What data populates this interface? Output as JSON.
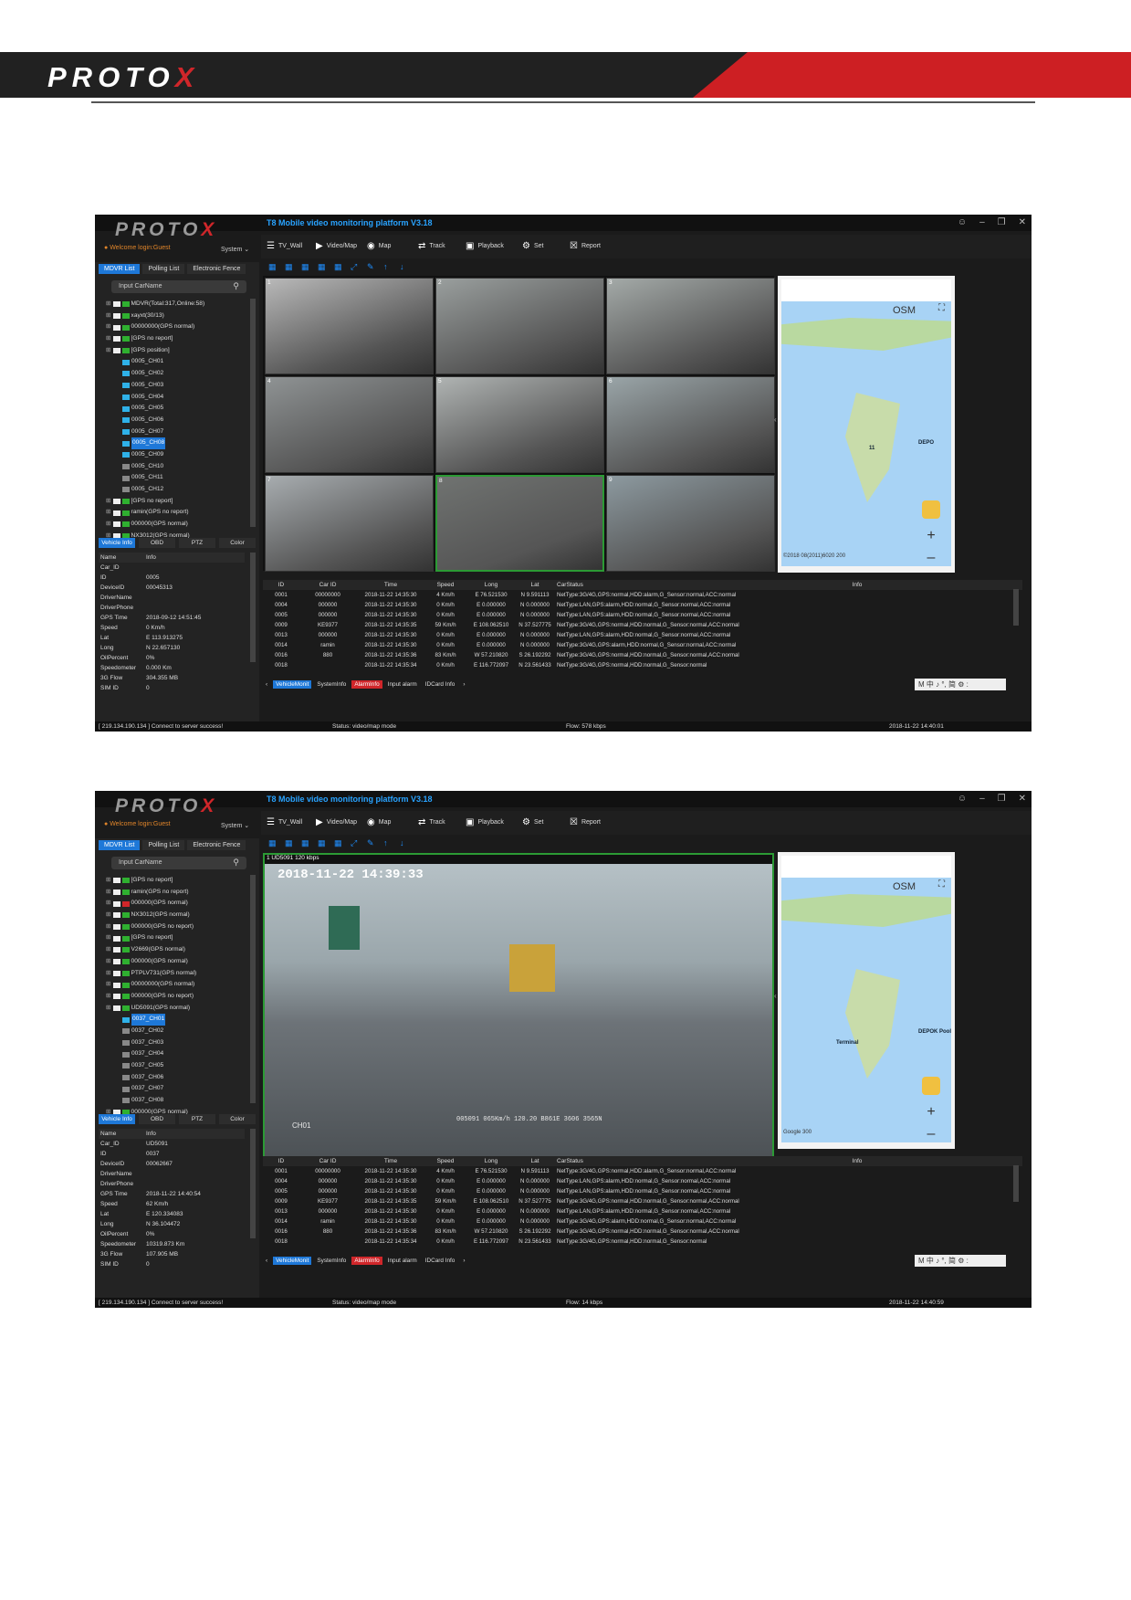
{
  "doc": {
    "brand_left": "PROTO",
    "brand_right": "X"
  },
  "screens": [
    {
      "app_title": "T8 Mobile video monitoring platform V3.18",
      "welcome": "Welcome login:Guest",
      "system_menu": "System",
      "toolbar": [
        "TV_Wall",
        "Video/Map",
        "Map",
        "Track",
        "Playback",
        "Set",
        "Report"
      ],
      "left_tabs": [
        "MDVR List",
        "Polling List",
        "Electronic Fence"
      ],
      "search_placeholder": "Input CarName",
      "tree": [
        "MDVR(Total:317,Online:58)",
        "xayxt(30/13)",
        "00000000(GPS normal)",
        "[GPS no report]",
        "[GPS position]",
        "0005_CH01",
        "0005_CH02",
        "0005_CH03",
        "0005_CH04",
        "0005_CH05",
        "0005_CH06",
        "0005_CH07",
        "0005_CH08",
        "0005_CH09",
        "0005_CH10",
        "0005_CH11",
        "0005_CH12",
        "[GPS no report]",
        "ramin(GPS no report)",
        "000000(GPS normal)",
        "NX3012(GPS normal)"
      ],
      "bottom_tabs": [
        "Vehicle Info",
        "OBD",
        "PTZ",
        "Color"
      ],
      "info_head": [
        "Name",
        "Info"
      ],
      "info": [
        [
          "Car_ID",
          ""
        ],
        [
          "ID",
          "0005"
        ],
        [
          "DeviceID",
          "00045313"
        ],
        [
          "DriverName",
          ""
        ],
        [
          "DriverPhone",
          ""
        ],
        [
          "GPS Time",
          "2018-09-12 14:51:45"
        ],
        [
          "Speed",
          "0 Km/h"
        ],
        [
          "Lat",
          "E 113.913275"
        ],
        [
          "Long",
          "N 22.657130"
        ],
        [
          "OilPercent",
          "0%"
        ],
        [
          "Speedometer",
          "0.000 Km"
        ],
        [
          "3G Flow",
          "304.355 MB"
        ],
        [
          "SIM ID",
          "0"
        ]
      ],
      "cams": [
        "1",
        "2",
        "3",
        "4",
        "5",
        "6",
        "7",
        "8",
        "9"
      ],
      "map_label": "OSM",
      "map_pins": [
        "11",
        "DEPO"
      ],
      "map_footer": "©2018 08(2011)6020   200",
      "status_left": "[ 219.134.190.134 ] Connect to server success!",
      "status_mid": "Status: video/map mode",
      "status_flow": "Flow: 578 kbps",
      "status_time": "2018-11-22 14:40:01"
    },
    {
      "app_title": "T8 Mobile video monitoring platform V3.18",
      "welcome": "Welcome login:Guest",
      "system_menu": "System",
      "toolbar": [
        "TV_Wall",
        "Video/Map",
        "Map",
        "Track",
        "Playback",
        "Set",
        "Report"
      ],
      "left_tabs": [
        "MDVR List",
        "Polling List",
        "Electronic Fence"
      ],
      "search_placeholder": "Input CarName",
      "tree": [
        "[GPS no report]",
        "ramin(GPS no report)",
        "000000(GPS normal)",
        "NX3012(GPS normal)",
        "000000(GPS no report)",
        "[GPS no report]",
        "V2669(GPS normal)",
        "000000(GPS normal)",
        "PTPLV731(GPS normal)",
        "00000000(GPS normal)",
        "000000(GPS no report)",
        "UD5091(GPS normal)",
        "0037_CH01",
        "0037_CH02",
        "0037_CH03",
        "0037_CH04",
        "0037_CH05",
        "0037_CH06",
        "0037_CH07",
        "0037_CH08",
        "000000(GPS normal)"
      ],
      "bottom_tabs": [
        "Vehicle Info",
        "OBD",
        "PTZ",
        "Color"
      ],
      "info_head": [
        "Name",
        "Info"
      ],
      "info": [
        [
          "Car_ID",
          "UD5091"
        ],
        [
          "ID",
          "0037"
        ],
        [
          "DeviceID",
          "00062667"
        ],
        [
          "DriverName",
          ""
        ],
        [
          "DriverPhone",
          ""
        ],
        [
          "GPS Time",
          "2018-11-22 14:40:54"
        ],
        [
          "Speed",
          "62 Km/h"
        ],
        [
          "Lat",
          "E 120.334083"
        ],
        [
          "Long",
          "N 36.104472"
        ],
        [
          "OilPercent",
          "0%"
        ],
        [
          "Speedometer",
          "10319.873 Km"
        ],
        [
          "3G Flow",
          "107.905 MB"
        ],
        [
          "SIM ID",
          "0"
        ]
      ],
      "video_label": "1  UD5091  120 kbps",
      "video_time": "2018-11-22 14:39:33",
      "video_channel": "CH01",
      "video_overlay": "005091  065Km/h  120.20  B861E  3606 3565N",
      "map_label": "OSM",
      "map_pins": [
        "DEPOK Pool",
        "Terminal"
      ],
      "map_footer": "Google   300",
      "status_left": "[ 219.134.190.134 ] Connect to server success!",
      "status_mid": "Status: video/map mode",
      "status_flow": "Flow: 14 kbps",
      "status_time": "2018-11-22 14:40:59"
    }
  ],
  "table": {
    "headers": [
      "ID",
      "Car ID",
      "Time",
      "Speed",
      "Long",
      "Lat",
      "CarStatus",
      "Info"
    ],
    "rows": [
      [
        "0001",
        "00000000",
        "2018-11-22 14:35:30",
        "4 Km/h",
        "E 76.521530",
        "N 9.591113",
        "NetType:3G/4G,GPS:normal,HDD:alarm,G_Sensor:normal,ACC:normal",
        ""
      ],
      [
        "0004",
        "000000",
        "2018-11-22 14:35:30",
        "0 Km/h",
        "E 0.000000",
        "N 0.000000",
        "NetType:LAN,GPS:alarm,HDD:normal,G_Sensor:normal,ACC:normal",
        ""
      ],
      [
        "0005",
        "000000",
        "2018-11-22 14:35:30",
        "0 Km/h",
        "E 0.000000",
        "N 0.000000",
        "NetType:LAN,GPS:alarm,HDD:normal,G_Sensor:normal,ACC:normal",
        ""
      ],
      [
        "0009",
        "KE9377",
        "2018-11-22 14:35:35",
        "59 Km/h",
        "E 108.062510",
        "N 37.527775",
        "NetType:3G/4G,GPS:normal,HDD:normal,G_Sensor:normal,ACC:normal",
        ""
      ],
      [
        "0013",
        "000000",
        "2018-11-22 14:35:30",
        "0 Km/h",
        "E 0.000000",
        "N 0.000000",
        "NetType:LAN,GPS:alarm,HDD:normal,G_Sensor:normal,ACC:normal",
        ""
      ],
      [
        "0014",
        "ramin",
        "2018-11-22 14:35:30",
        "0 Km/h",
        "E 0.000000",
        "N 0.000000",
        "NetType:3G/4G,GPS:alarm,HDD:normal,G_Sensor:normal,ACC:normal",
        ""
      ],
      [
        "0016",
        "880",
        "2018-11-22 14:35:36",
        "83 Km/h",
        "W 57.210820",
        "S 26.192292",
        "NetType:3G/4G,GPS:normal,HDD:normal,G_Sensor:normal,ACC:normal",
        ""
      ],
      [
        "0018",
        "",
        "2018-11-22 14:35:34",
        "0 Km/h",
        "E 116.772097",
        "N 23.561433",
        "NetType:3G/4G,GPS:normal,HDD:normal,G_Sensor:normal",
        ""
      ]
    ]
  },
  "bottom_tabs2": [
    "VehicleMonit",
    "SystemInfo",
    "AlarmInfo",
    "Input alarm",
    "IDCard Info"
  ],
  "ime": "M 中 ♪ °, 简 ⚙ :"
}
